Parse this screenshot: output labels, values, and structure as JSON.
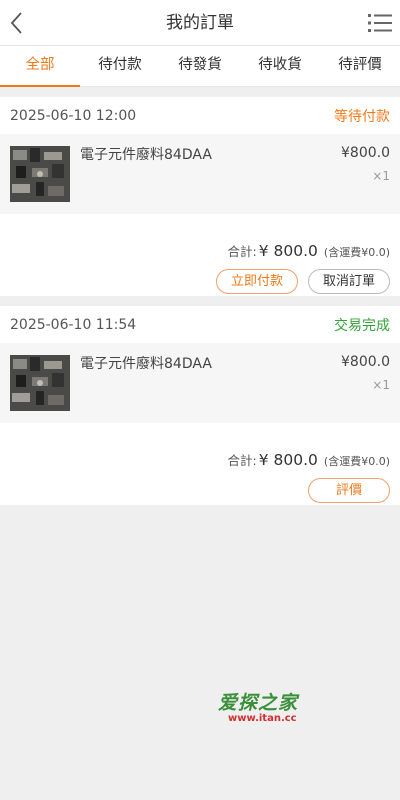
{
  "header": {
    "title": "我的訂單"
  },
  "tabs": [
    {
      "label": "全部",
      "active": true
    },
    {
      "label": "待付款",
      "active": false
    },
    {
      "label": "待發貨",
      "active": false
    },
    {
      "label": "待收貨",
      "active": false
    },
    {
      "label": "待評價",
      "active": false
    }
  ],
  "orders": [
    {
      "datetime": "2025-06-10 12:00",
      "status": "等待付款",
      "item": {
        "name": "電子元件廢料84DAA",
        "price": "¥800.0",
        "qty": "×1"
      },
      "total_label": "合計:",
      "total_amount": "¥ 800.0",
      "shipping_note": "(含運費¥0.0)",
      "actions": [
        "立即付款",
        "取消訂單"
      ]
    },
    {
      "datetime": "2025-06-10 11:54",
      "status": "交易完成",
      "item": {
        "name": "電子元件廢料84DAA",
        "price": "¥800.0",
        "qty": "×1"
      },
      "total_label": "合計:",
      "total_amount": "¥ 800.0",
      "shipping_note": "(含運費¥0.0)",
      "actions": [
        "評價"
      ]
    }
  ],
  "watermark": {
    "logo_text": "爱探之家",
    "url": "www.itan.cc"
  },
  "colors": {
    "accent": "#f07a1a",
    "success": "#36a33a",
    "background": "#efefef"
  },
  "icons": {
    "back": "chevron-left-icon",
    "menu": "list-menu-icon"
  }
}
